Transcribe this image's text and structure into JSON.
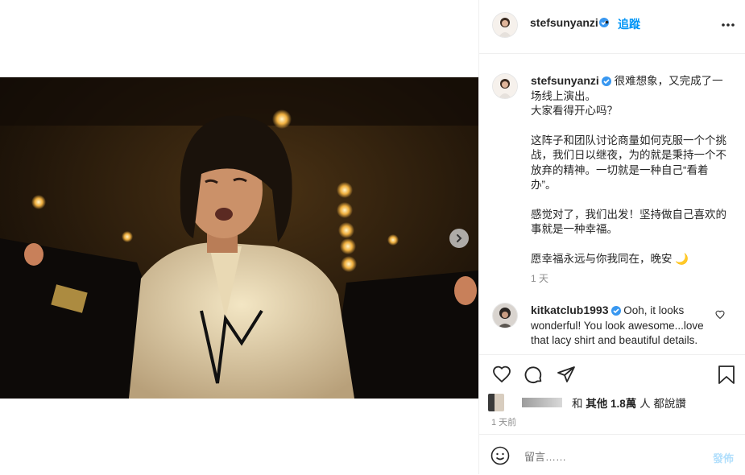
{
  "post": {
    "username": "stefsunyanzi",
    "follow_label": "追蹤",
    "dot": "•"
  },
  "caption": {
    "username": "stefsunyanzi",
    "lines": [
      "很难想象，又完成了一场线上演出。",
      "大家看得开心吗？",
      "这阵子和团队讨论商量如何克服一个个挑战，我们日以继夜，为的就是秉持一个不放弃的精神。一切就是一种自己“看着办”。",
      "感觉对了，我们出发！坚持做自己喜欢的事就是一种幸福。",
      "愿幸福永远与你我同在，晚安 🌙"
    ],
    "time": "1 天"
  },
  "comment": {
    "username": "kitkatclub1993",
    "text": "Ooh, it looks wonderful! You look awesome...love that lacy shirt and beautiful details."
  },
  "likes": {
    "and_label": "和",
    "others_label": "其他",
    "count": "1.8萬",
    "suffix": "人 都說讚"
  },
  "date": "1 天前",
  "add_comment": {
    "placeholder": "留言……",
    "post_label": "發佈"
  },
  "colors": {
    "accent": "#0095f6",
    "verified": "#3897f0",
    "border": "#efefef"
  }
}
